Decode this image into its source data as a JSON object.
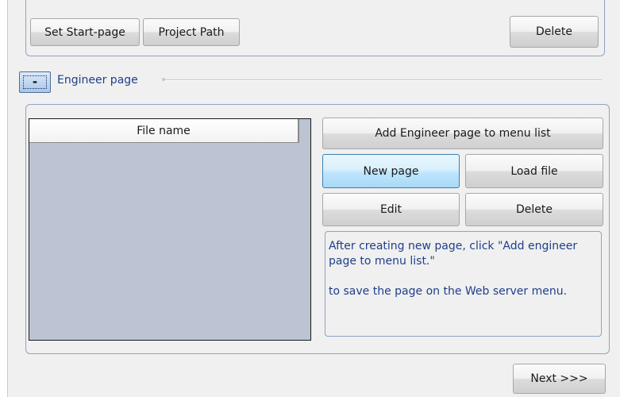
{
  "top_toolbar": {
    "set_start_page": "Set Start-page",
    "project_path": "Project Path",
    "delete": "Delete"
  },
  "engineer_section": {
    "collapse_symbol": "-",
    "title": "Engineer page"
  },
  "file_list": {
    "column_header": "File name",
    "rows": []
  },
  "actions": {
    "add_to_menu": "Add Engineer page to menu list",
    "new_page": "New page",
    "load_file": "Load file",
    "edit": "Edit",
    "delete": "Delete"
  },
  "info": {
    "line1": "After creating new page, click \"Add engineer page to menu list.\"",
    "line2": "to save the page on the Web server menu."
  },
  "footer": {
    "next": "Next >>>"
  }
}
